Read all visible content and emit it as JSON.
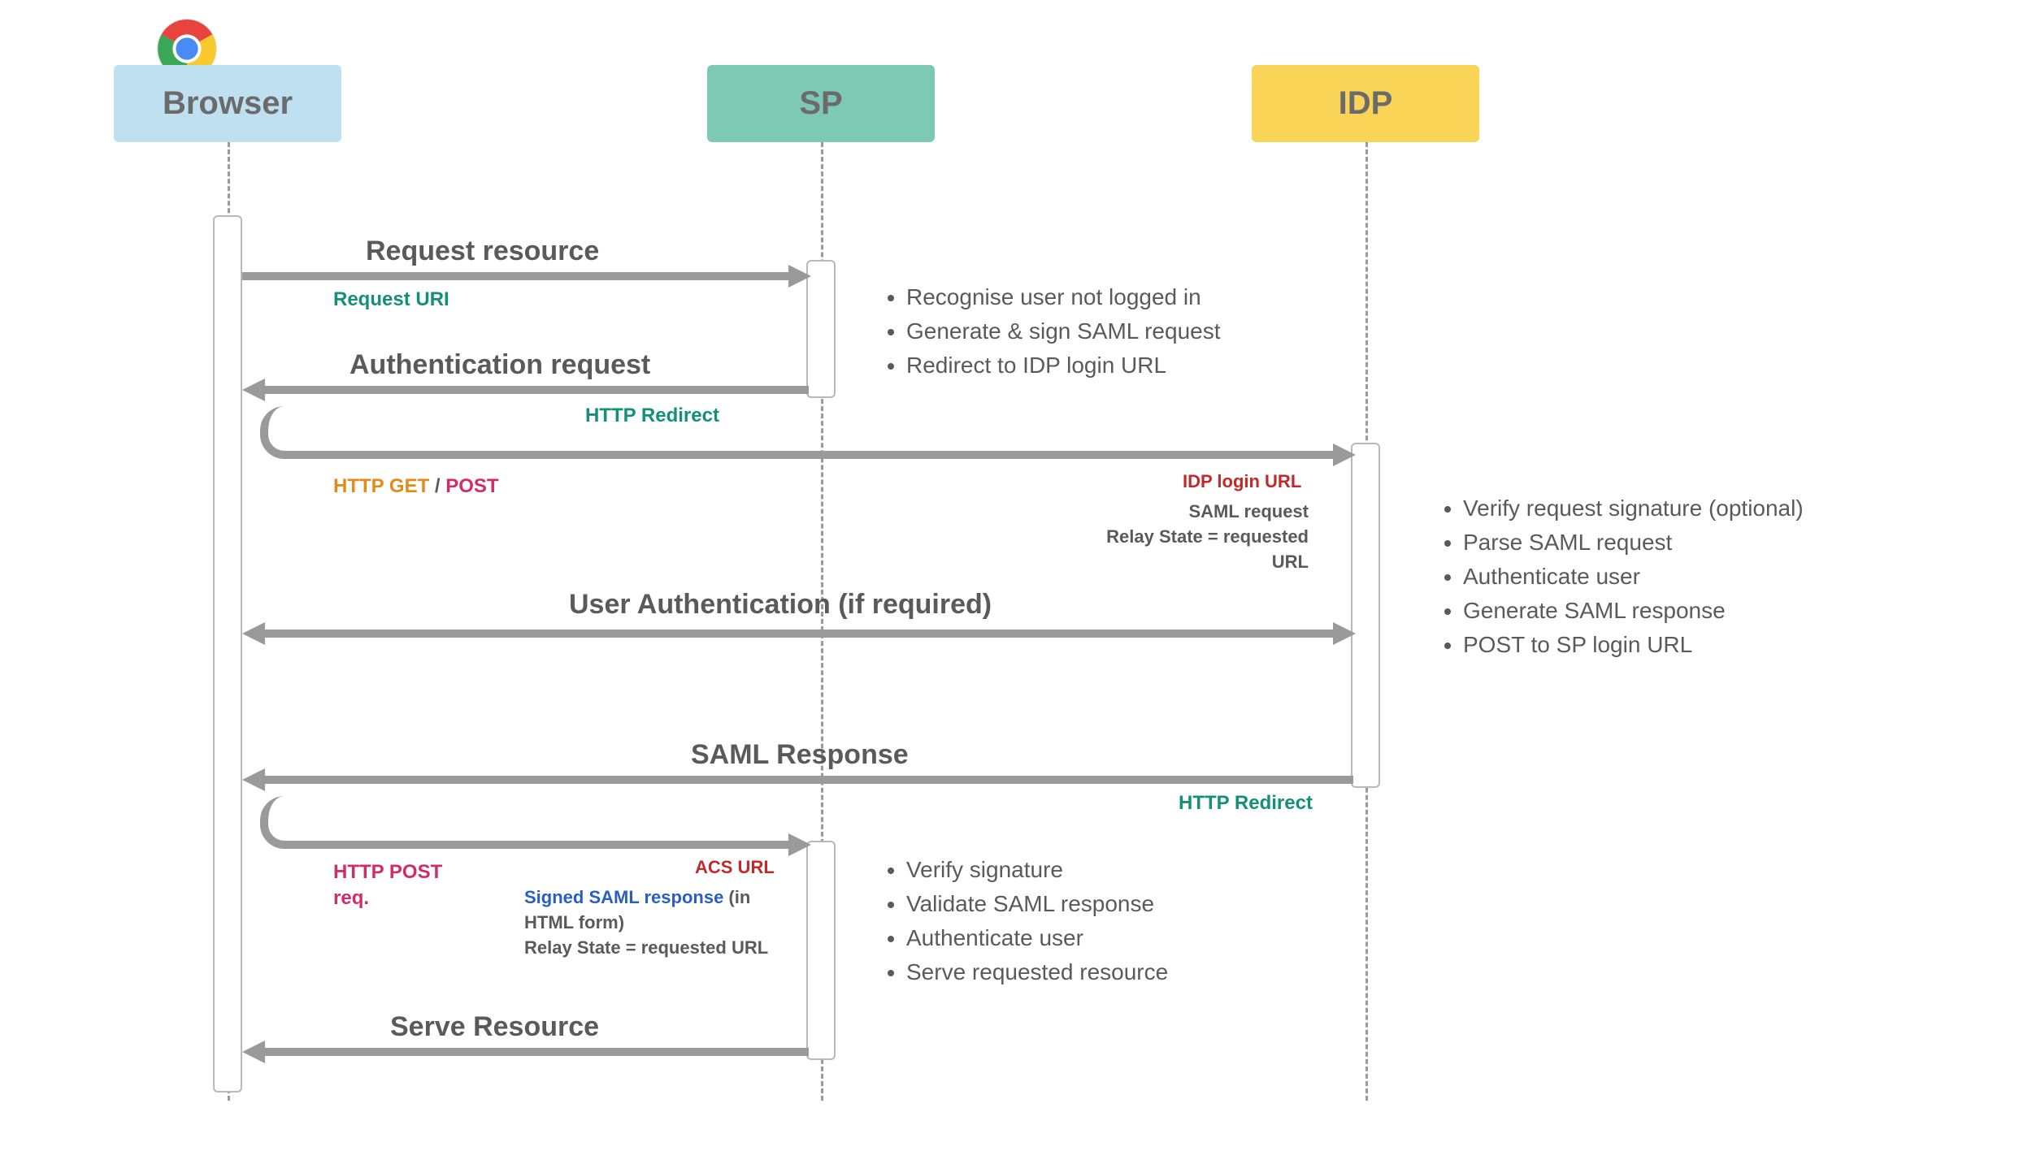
{
  "participants": {
    "browser": "Browser",
    "sp": "SP",
    "idp": "IDP"
  },
  "messages": {
    "request_resource": "Request resource",
    "request_uri": "Request URI",
    "auth_request": "Authentication request",
    "http_redirect_1": "HTTP Redirect",
    "http_get": "HTTP GET",
    "slash": " / ",
    "post": "POST",
    "idp_login_url": "IDP login URL",
    "saml_request": "SAML request",
    "relay_state_1": "Relay State = requested URL",
    "user_auth": "User Authentication (if required)",
    "saml_response": "SAML Response",
    "http_redirect_2": "HTTP Redirect",
    "http_post": "HTTP POST",
    "req": "req.",
    "acs_url": "ACS URL",
    "signed_saml_response": "Signed SAML response",
    "in_html_form": " (in HTML form)",
    "relay_state_2": "Relay State = requested URL",
    "serve_resource": "Serve Resource"
  },
  "notes": {
    "sp_initial": [
      "Recognise user not logged in",
      "Generate & sign SAML request",
      "Redirect to IDP login URL"
    ],
    "idp_process": [
      "Verify request signature (optional)",
      "Parse SAML request",
      "Authenticate user",
      "Generate SAML response",
      "POST to SP login URL"
    ],
    "sp_final": [
      "Verify signature",
      "Validate SAML response",
      "Authenticate user",
      "Serve requested resource"
    ]
  }
}
